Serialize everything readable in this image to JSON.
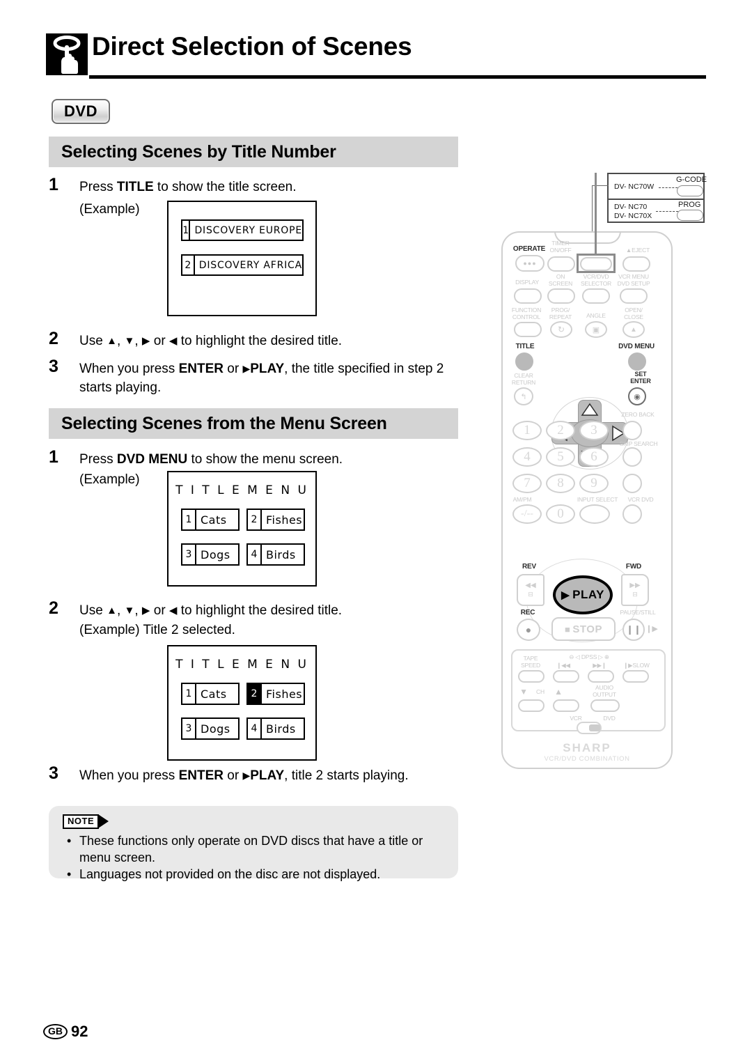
{
  "header": {
    "title": "Direct Selection of Scenes",
    "icon": "hand-press-button-icon"
  },
  "badge": {
    "label": "DVD"
  },
  "sections": [
    {
      "heading": "Selecting Scenes by Title Number",
      "steps": [
        {
          "num": "1",
          "text_before": "Press ",
          "bold": "TITLE",
          "text_after": " to show the title screen."
        },
        {
          "num": "2"
        },
        {
          "num": "3"
        }
      ],
      "example_label": "(Example)"
    },
    {
      "heading": "Selecting Scenes from the Menu Screen",
      "example_label": "(Example)",
      "example_label2": "(Example) Title 2 selected."
    }
  ],
  "step1a": {
    "num": "1",
    "pre": "Press ",
    "bold": "TITLE",
    "post": " to show the title screen."
  },
  "step2a": {
    "num": "2",
    "pre": "Use ",
    "post": " to highlight the desired title.",
    "sep1": ", ",
    "sep2": ", ",
    "or": " or "
  },
  "step3a": {
    "num": "3",
    "pre": "When you press ",
    "b1": "ENTER",
    "mid": " or ",
    "b2": "PLAY",
    "post": ",  the title specified in step 2 starts playing."
  },
  "step1b": {
    "num": "1",
    "pre": "Press ",
    "bold": "DVD MENU",
    "post": " to show the menu screen."
  },
  "step2b": {
    "num": "2",
    "pre": "Use ",
    "post": " to highlight the desired title.",
    "example": "(Example) Title 2 selected."
  },
  "step3b": {
    "num": "3",
    "pre": "When you press ",
    "b1": "ENTER",
    "mid": " or ",
    "b2": "PLAY",
    "post": ", title 2 starts playing."
  },
  "title_screen": {
    "rows": [
      {
        "num": "1",
        "text": "DISCOVERY  EUROPE",
        "highlighted": false
      },
      {
        "num": "2",
        "text": "DISCOVERY  AFRICA",
        "highlighted": false
      }
    ]
  },
  "menu_screen_1": {
    "heading": "T I T L E   M E N U",
    "items": [
      {
        "num": "1",
        "text": "Cats",
        "highlighted": false
      },
      {
        "num": "2",
        "text": "Fishes",
        "highlighted": false
      },
      {
        "num": "3",
        "text": "Dogs",
        "highlighted": false
      },
      {
        "num": "4",
        "text": "Birds",
        "highlighted": false
      }
    ]
  },
  "menu_screen_2": {
    "heading": "T I T L E   M E N U",
    "items": [
      {
        "num": "1",
        "text": "Cats",
        "highlighted": false
      },
      {
        "num": "2",
        "text": "Fishes",
        "highlighted": true
      },
      {
        "num": "3",
        "text": "Dogs",
        "highlighted": false
      },
      {
        "num": "4",
        "text": "Birds",
        "highlighted": false
      }
    ]
  },
  "note": {
    "tag": "NOTE",
    "items": [
      "These functions only operate on DVD discs that have a title or menu screen.",
      "Languages not provided on the disc are not displayed."
    ]
  },
  "footer": {
    "region": "GB",
    "page": "92"
  },
  "remote": {
    "callout": {
      "model_w": "DV- NC70W",
      "btn_w": "G-CODE",
      "model_a": "DV- NC70",
      "model_b": "DV- NC70X",
      "btn_b": "PROG"
    },
    "labels": {
      "operate": "OPERATE",
      "timer_on_off": "TIMER\nON/OFF",
      "eject": "EJECT",
      "display": "DISPLAY",
      "on_screen": "ON\nSCREEN",
      "vcr_dvd_selector": "VCR/DVD\nSELECTOR",
      "vcr_menu_dvd_setup": "VCR MENU\nDVD SETUP",
      "function_control": "FUNCTION\nCONTROL",
      "prog_repeat": "PROG/\nREPEAT",
      "angle": "ANGLE",
      "open_close": "OPEN/\nCLOSE",
      "title": "TITLE",
      "dvd_menu": "DVD MENU",
      "clear_return": "CLEAR\nRETURN",
      "set_enter": "SET\nENTER",
      "zero_back": "ZERO BACK",
      "skip_search": "SKIP SEARCH",
      "am_pm": "AM/PM",
      "dash": "-/--",
      "input_select": "INPUT SELECT",
      "vcr_dvd": "VCR    DVD",
      "rev": "REV",
      "fwd": "FWD",
      "play": "PLAY",
      "stop": "STOP",
      "rec": "REC",
      "pause_still": "PAUSE/STILL",
      "tape_speed": "TAPE\nSPEED",
      "skip": "SKIP",
      "dpss": "DPSS",
      "slow": "SLOW",
      "ch": "CH",
      "audio_output": "AUDIO\nOUTPUT",
      "vcr": "VCR",
      "dvd": "DVD",
      "brand": "SHARP",
      "brand_sub": "VCR/DVD COMBINATION"
    },
    "numbers": [
      "1",
      "2",
      "3",
      "4",
      "5",
      "6",
      "7",
      "8",
      "9",
      "0"
    ]
  }
}
